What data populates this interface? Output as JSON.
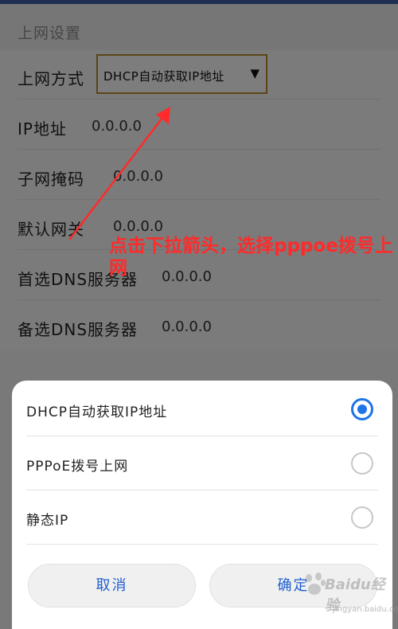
{
  "page": {
    "section_title": "上网设置"
  },
  "form": {
    "method_label": "上网方式",
    "method_value": "DHCP自动获取IP地址",
    "rows": [
      {
        "label": "IP地址",
        "value": "0.0.0.0"
      },
      {
        "label": "子网掩码",
        "value": "0.0.0.0"
      },
      {
        "label": "默认网关",
        "value": "0.0.0.0"
      },
      {
        "label": "首选DNS服务器",
        "value": "0.0.0.0"
      },
      {
        "label": "备选DNS服务器",
        "value": "0.0.0.0"
      }
    ]
  },
  "annotation": {
    "text": "点击下拉箭头，选择pppoe拨号上网",
    "color": "#ff2a2a"
  },
  "sheet": {
    "options": [
      {
        "label": "DHCP自动获取IP地址",
        "selected": true
      },
      {
        "label": "PPPoE拨号上网",
        "selected": false
      },
      {
        "label": "静态IP",
        "selected": false
      }
    ],
    "cancel_label": "取消",
    "confirm_label": "确定"
  },
  "watermark": {
    "text": "Baidu经验",
    "sub": "jingyan.baidu.com"
  },
  "colors": {
    "accent": "#1f74e8",
    "select_border": "#b58a2f",
    "button_text": "#1f5fd0"
  }
}
